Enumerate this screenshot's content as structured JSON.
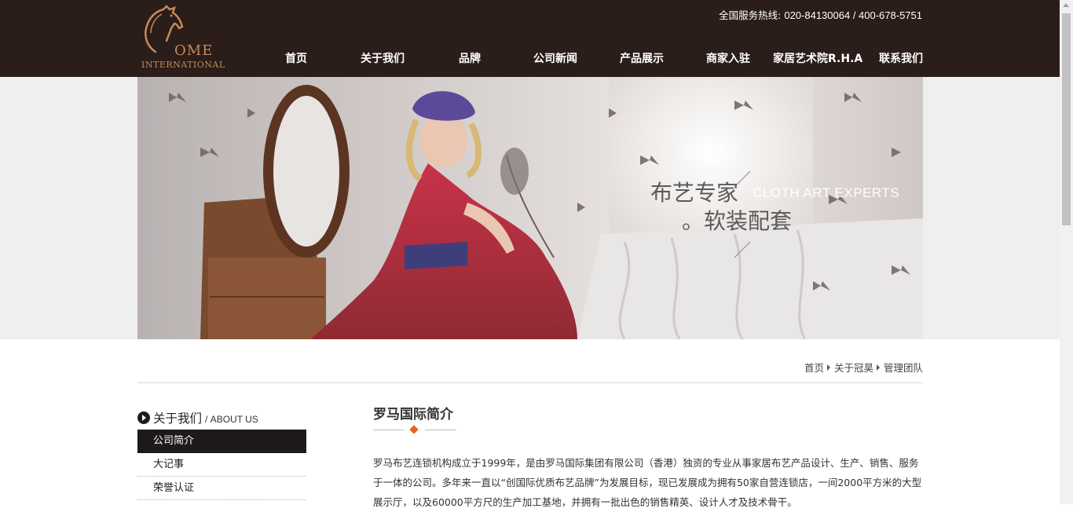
{
  "header": {
    "logo": {
      "brand_main": "OME",
      "brand_sub": "INTERNATIONAL"
    },
    "hotline_label": "全国服务热线:",
    "hotline_numbers": "020-84130064 / 400-678-5751",
    "nav": [
      {
        "label": "首页"
      },
      {
        "label": "关于我们"
      },
      {
        "label": "品牌"
      },
      {
        "label": "公司新闻"
      },
      {
        "label": "产品展示"
      },
      {
        "label": "商家入驻"
      },
      {
        "label": "家居艺术院R.H.A"
      },
      {
        "label": "联系我们"
      }
    ]
  },
  "banner": {
    "caption_cn_1": "布艺专家",
    "caption_en": "CLOTH ART EXPERTS",
    "caption_cn_2": "。软装配套"
  },
  "breadcrumb": {
    "items": [
      "首页",
      "关于冠昊",
      "管理团队"
    ]
  },
  "sidebar": {
    "title_cn": "关于我们",
    "title_en": "/ ABOUT US",
    "items": [
      {
        "label": "公司简介",
        "active": true
      },
      {
        "label": "大记事",
        "active": false
      },
      {
        "label": "荣誉认证",
        "active": false
      }
    ]
  },
  "main": {
    "title": "罗马国际简介",
    "body": "罗马布艺连锁机构成立于1999年，是由罗马国际集团有限公司（香港）独资的专业从事家居布艺产品设计、生产、销售、服务于一体的公司。多年来一直以“创国际优质布艺品牌”为发展目标，现已发展成为拥有50家自营连锁店，一间2000平方米的大型展示厅，以及60000平方尺的生产加工基地，并拥有一批出色的销售精英、设计人才及技术骨干。"
  },
  "colors": {
    "header_bg": "#2a1d1a",
    "logo_accent": "#c88a54",
    "active_menu_bg": "#1e1a1a",
    "title_diamond": "#e8621e"
  }
}
